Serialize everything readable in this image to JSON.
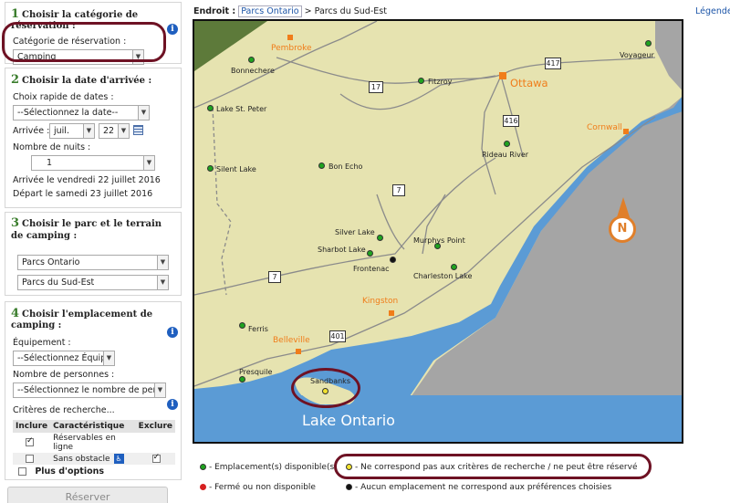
{
  "steps": {
    "category": {
      "number": "1",
      "title": "Choisir la catégorie de réservation :",
      "label": "Catégorie de réservation :",
      "value": "Camping"
    },
    "date": {
      "number": "2",
      "title": "Choisir la date d'arrivée :",
      "quick_label": "Choix rapide de dates :",
      "quick_value": "--Sélectionnez la date--",
      "arrival_label": "Arrivée :",
      "month": "juil.",
      "day": "22",
      "nights_label": "Nombre de nuits :",
      "nights": "1",
      "arrival_text": "Arrivée le vendredi 22 juillet 2016",
      "departure_text": "Départ le samedi 23 juillet 2016"
    },
    "park": {
      "number": "3",
      "title": "Choisir le parc et le terrain de camping :",
      "park_value": "Parcs Ontario",
      "region_value": "Parcs du Sud-Est"
    },
    "site": {
      "number": "4",
      "title": "Choisir l'emplacement de camping :",
      "equipment_label": "Équipement :",
      "equipment_value": "--Sélectionnez Équip",
      "people_label": "Nombre de personnes :",
      "people_value": "--Sélectionnez le nombre de pers",
      "criteria_label": "Critères de recherche...",
      "table_headers": [
        "Inclure",
        "Caractéristique",
        "Exclure"
      ],
      "rows": [
        {
          "feature": "Réservables en ligne",
          "include": true,
          "exclude": false
        },
        {
          "feature": "Sans obstacle",
          "include": false,
          "exclude": true
        }
      ],
      "more_options": "Plus d'options"
    }
  },
  "reserve_button": "Réserver",
  "breadcrumb": {
    "label": "Endroit :",
    "link": "Parcs Ontario",
    "separator": ">",
    "current": "Parcs du Sud-Est"
  },
  "legend_link": "Légende",
  "map": {
    "colors": {
      "land": "#e6e3b0",
      "water": "#5b9bd5",
      "outside": "#a5a5a5",
      "forest": "#5d7a3a",
      "city": "#f07d1a",
      "available": "#1fa31f",
      "unavailable": "#f2e230",
      "none": "#111111",
      "closed": "#d62020"
    },
    "lake_label": "Lake Ontario",
    "compass_label": "N",
    "cities": [
      "Pembroke",
      "Ottawa",
      "Cornwall",
      "Kingston",
      "Belleville"
    ],
    "highways": [
      "417",
      "17",
      "416",
      "7",
      "7",
      "401"
    ],
    "parks": [
      {
        "name": "Voyageur",
        "status": "available"
      },
      {
        "name": "Bonnechere",
        "status": "available"
      },
      {
        "name": "Fitzroy",
        "status": "available"
      },
      {
        "name": "Lake St. Peter",
        "status": "available"
      },
      {
        "name": "Rideau River",
        "status": "available"
      },
      {
        "name": "Silent Lake",
        "status": "available"
      },
      {
        "name": "Bon Echo",
        "status": "available"
      },
      {
        "name": "Silver Lake",
        "status": "available"
      },
      {
        "name": "Murphys Point",
        "status": "available"
      },
      {
        "name": "Sharbot Lake",
        "status": "available"
      },
      {
        "name": "Frontenac",
        "status": "none"
      },
      {
        "name": "Charleston Lake",
        "status": "available"
      },
      {
        "name": "Ferris",
        "status": "available"
      },
      {
        "name": "Presquile",
        "status": "available"
      },
      {
        "name": "Sandbanks",
        "status": "unavailable"
      }
    ]
  },
  "legend": {
    "available": "- Emplacement(s) disponible(s)",
    "unavailable": "- Ne correspond pas aux critères de recherche / ne peut être réservé",
    "closed": "- Fermé ou non disponible",
    "none": "- Aucun emplacement ne correspond aux préférences choisies"
  }
}
